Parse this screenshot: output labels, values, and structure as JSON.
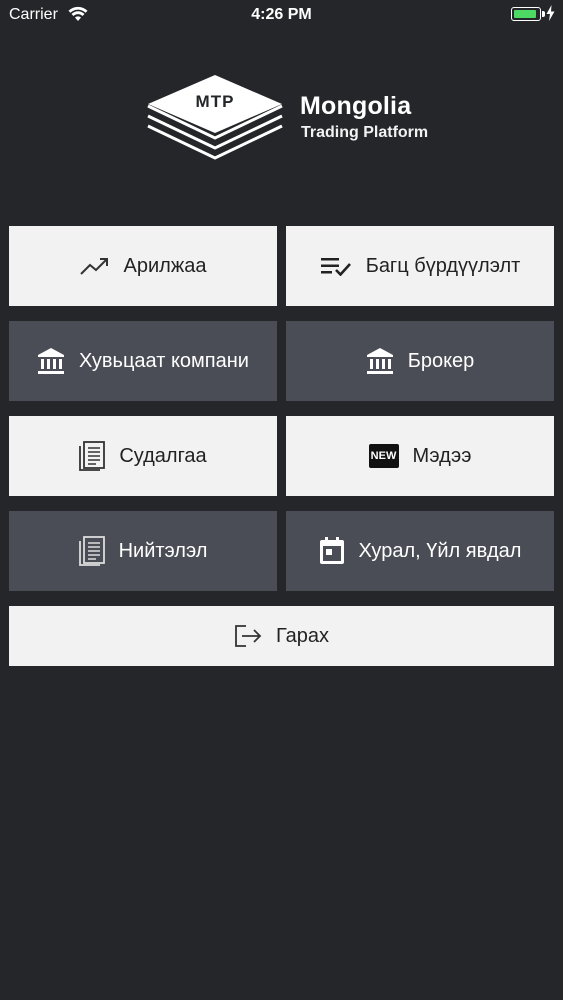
{
  "status_bar": {
    "carrier": "Carrier",
    "time": "4:26 PM",
    "battery_color": "#4cd964"
  },
  "logo": {
    "mark_text": "MTP",
    "title": "Mongolia",
    "subtitle": "Trading Platform"
  },
  "menu": {
    "trading": {
      "label": "Арилжаа",
      "icon": "trending-up-icon"
    },
    "portfolio": {
      "label": "Багц бүрдүүлэлт",
      "icon": "playlist-check-icon"
    },
    "listed_companies": {
      "label": "Хувьцаат компани",
      "icon": "bank-icon"
    },
    "broker": {
      "label": "Брокер",
      "icon": "bank-icon"
    },
    "research": {
      "label": "Судалгаа",
      "icon": "document-icon"
    },
    "news": {
      "label": "Мэдээ",
      "icon": "new-badge-icon",
      "badge_text": "NEW"
    },
    "articles": {
      "label": "Нийтэлэл",
      "icon": "document-icon"
    },
    "events": {
      "label": "Хурал, Үйл явдал",
      "icon": "calendar-icon"
    },
    "logout": {
      "label": "Гарах",
      "icon": "exit-icon"
    }
  },
  "colors": {
    "background": "#25262a",
    "tile_light": "#f2f2f2",
    "tile_dark": "#4a4d55"
  }
}
